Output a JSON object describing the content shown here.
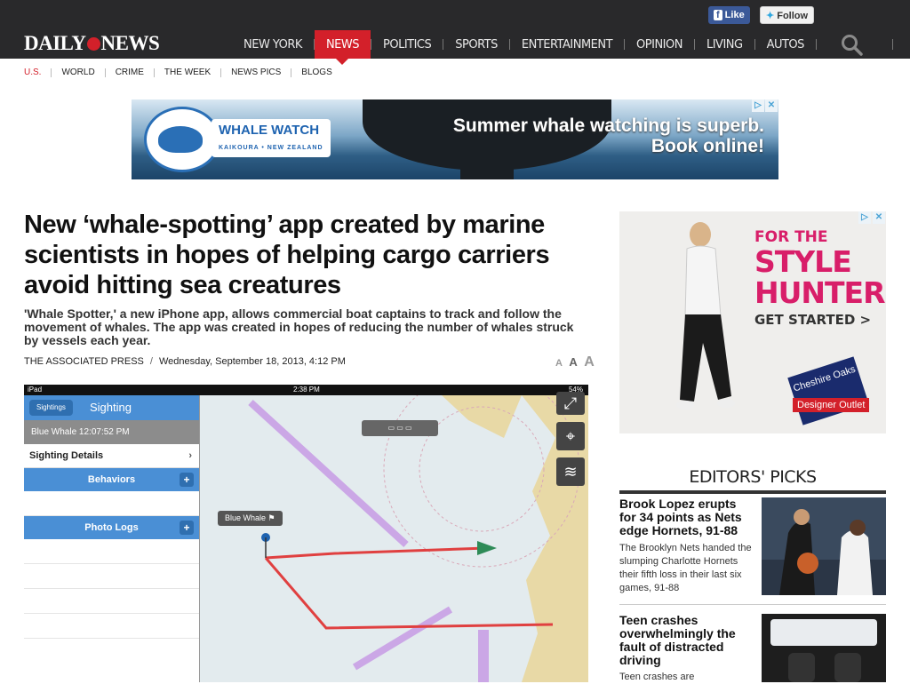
{
  "header": {
    "logo_left": "DAILY",
    "logo_right": "NEWS",
    "facebook_label": "Like",
    "twitter_label": "Follow",
    "nav": [
      "NEW YORK",
      "NEWS",
      "POLITICS",
      "SPORTS",
      "ENTERTAINMENT",
      "OPINION",
      "LIVING",
      "AUTOS"
    ],
    "active_nav": "NEWS"
  },
  "subnav": [
    "U.S.",
    "WORLD",
    "CRIME",
    "THE WEEK",
    "NEWS PICS",
    "BLOGS"
  ],
  "top_ad": {
    "brand": "WHALE WATCH",
    "brand_sub": "KAIKOURA • NEW ZEALAND",
    "headline_line1": "Summer whale watching is superb.",
    "headline_line2": "Book online!"
  },
  "article": {
    "title": "New ‘whale-spotting’ app created by marine scientists in hopes of helping cargo carriers avoid hitting sea creatures",
    "dek": "'Whale Spotter,' a new iPhone app, allows commercial boat captains to track and follow the movement of whales. The app was created in hopes of reducing the number of whales struck by vessels each year.",
    "author": "THE ASSOCIATED PRESS",
    "date": "Wednesday, September 18, 2013, 4:12 PM",
    "fontsize_labels": [
      "A",
      "A",
      "A"
    ]
  },
  "app_screenshot": {
    "status_left": "iPad",
    "status_time": "2:38 PM",
    "status_battery": "54%",
    "back_label": "Sightings",
    "panel_title": "Sighting",
    "whale_row": "Blue Whale 12:07:52 PM",
    "details_label": "Sighting Details",
    "behaviors_label": "Behaviors",
    "photo_logs_label": "Photo Logs",
    "callout": "Blue Whale"
  },
  "right_ad": {
    "line1": "FOR THE",
    "line2": "STYLE",
    "line3": "HUNTERS",
    "cta": "GET STARTED >",
    "badge": "Cheshire Oaks",
    "outlet": "Designer Outlet"
  },
  "editors_picks": {
    "title": "EDITORS' PICKS",
    "items": [
      {
        "title": "Brook Lopez erupts for 34 points as Nets edge Hornets, 91-88",
        "desc": "The Brooklyn Nets handed the slumping Charlotte Hornets their fifth loss in their last six games, 91-88"
      },
      {
        "title": "Teen crashes overwhelmingly the fault of distracted driving",
        "desc": "Teen crashes are"
      }
    ]
  }
}
